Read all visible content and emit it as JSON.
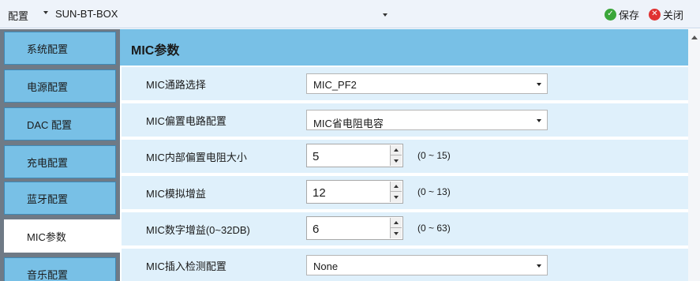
{
  "toolbar": {
    "config_label": "配置",
    "device_name": "SUN-BT-BOX",
    "save_label": "保存",
    "close_label": "关闭"
  },
  "nav": {
    "items": [
      {
        "label": "系统配置"
      },
      {
        "label": "电源配置"
      },
      {
        "label": "DAC 配置"
      },
      {
        "label": "充电配置"
      },
      {
        "label": "蓝牙配置"
      },
      {
        "label": "MIC参数"
      },
      {
        "label": "音乐配置"
      }
    ],
    "active_index": 5
  },
  "panel": {
    "title": "MIC参数",
    "rows": [
      {
        "label": "MIC通路选择",
        "type": "select",
        "value": "MIC_PF2"
      },
      {
        "label": "MIC偏置电路配置",
        "type": "select",
        "value": "MIC省电阻电容"
      },
      {
        "label": "MIC内部偏置电阻大小",
        "type": "spin",
        "value": "5",
        "range": "(0 ~ 15)"
      },
      {
        "label": "MIC模拟增益",
        "type": "spin",
        "value": "12",
        "range": "(0 ~ 13)"
      },
      {
        "label": "MIC数字增益(0~32DB)",
        "type": "spin",
        "value": "6",
        "range": "(0 ~ 63)"
      },
      {
        "label": "MIC插入检测配置",
        "type": "select",
        "value": "None"
      }
    ]
  },
  "colors": {
    "nav_bg": "#78c0e6",
    "row_bg": "#dff0fb",
    "save_icon": "#3aa63a",
    "close_icon": "#e03232"
  },
  "icons": [
    "check-icon",
    "x-icon",
    "chevron-down-icon",
    "scroll-up-icon"
  ]
}
